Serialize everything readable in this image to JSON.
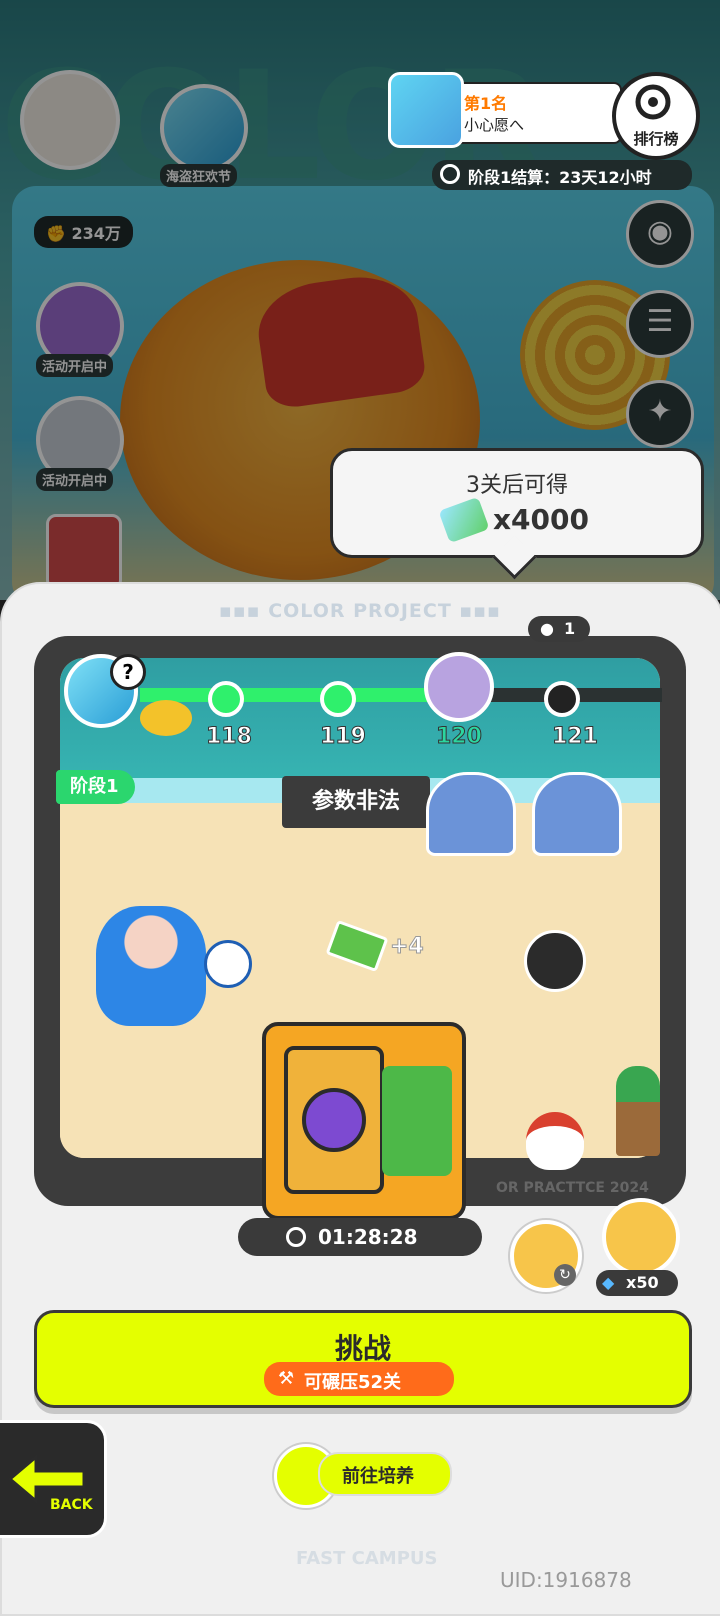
{
  "background": {
    "side_items": [
      {
        "label": "海盗狂欢节"
      },
      {
        "label": "234万"
      },
      {
        "label": "活动开启中"
      },
      {
        "label": "活动开启中"
      }
    ]
  },
  "leaderboard": {
    "rank": "第1名",
    "player_name": "小心愿へ",
    "button_label": "排行榜",
    "stage_countdown": "阶段1结算：23天12小时"
  },
  "tooltip": {
    "title": "3关后可得",
    "reward_amount": "x4000"
  },
  "sheet": {
    "header": "COLOR PROJECT",
    "online_count": "1",
    "progress_nodes": [
      "118",
      "119",
      "120",
      "121"
    ],
    "current_node_index": 2,
    "stage_tag": "阶段1",
    "error_tag": "参数非法",
    "cash_bonus": "+4",
    "map_footer_text": "OR PRACTTCE 2024",
    "timer": "01:28:28",
    "diamond_cost": "x50",
    "challenge_label": "挑战",
    "crush_label": "可碾压52关",
    "train_label": "前往培养",
    "back_label": "BACK",
    "footer_brand": "FAST CAMPUS",
    "uid": "UID:1916878"
  },
  "colors": {
    "accent_green": "#2ff06c",
    "challenge_yellow": "#e4ff00",
    "crush_orange": "#ff6b1a",
    "dark": "#3a3a3a"
  }
}
